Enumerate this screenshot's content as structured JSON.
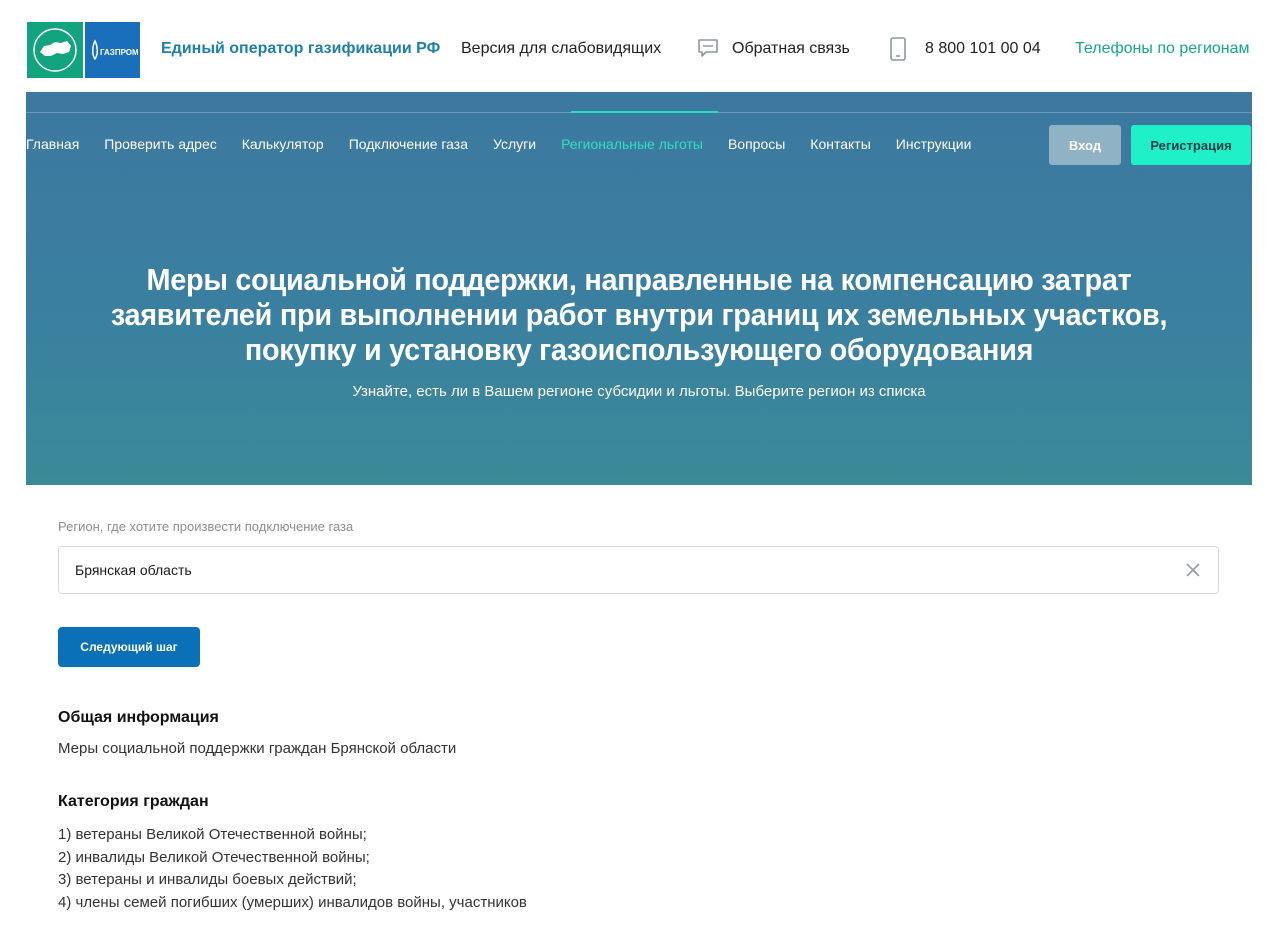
{
  "header": {
    "brand": "Единый оператор газификации РФ",
    "accessibility_link": "Версия для слабовидящих",
    "feedback_link": "Обратная связь",
    "phone": "8 800 101 00 04",
    "regions_link": "Телефоны по регионам",
    "logo_text_gazprom": "ГАЗПРОМ"
  },
  "nav": {
    "items": [
      {
        "label": "Главная"
      },
      {
        "label": "Проверить адрес"
      },
      {
        "label": "Калькулятор"
      },
      {
        "label": "Подключение газа"
      },
      {
        "label": "Услуги"
      },
      {
        "label": "Региональные льготы"
      },
      {
        "label": "Вопросы"
      },
      {
        "label": "Контакты"
      },
      {
        "label": "Инструкции"
      }
    ],
    "active_index": 5,
    "login_label": "Вход",
    "register_label": "Регистрация"
  },
  "hero": {
    "title": "Меры социальной поддержки, направленные на компенсацию затрат заявителей при выполнении работ внутри границ их земельных участков, покупку и установку газоиспользующего оборудования",
    "subtitle": "Узнайте, есть ли в Вашем регионе субсидии и льготы. Выберите регион из списка"
  },
  "form": {
    "region_label": "Регион, где хотите произвести подключение газа",
    "region_value": "Брянская область",
    "next_button": "Следующий шаг"
  },
  "info": {
    "general_title": "Общая информация",
    "general_text": "Меры социальной поддержки граждан Брянской области",
    "category_title": "Категория граждан",
    "categories": [
      "1) ветераны Великой Отечественной войны;",
      "2) инвалиды Великой Отечественной войны;",
      "3) ветераны и инвалиды боевых действий;",
      "4) члены семей погибших (умерших) инвалидов войны, участников"
    ]
  },
  "colors": {
    "brand_teal": "#13a886",
    "brand_blue": "#1f80a8",
    "hero_bg": "#3a7fa0",
    "nav_active": "#31e0bd",
    "register_bg": "#1ff0c8",
    "login_bg": "#8fb3c4",
    "primary_button": "#0a70b8"
  },
  "icons": {
    "feedback": "chat-bubble-icon",
    "phone": "mobile-phone-icon",
    "clear": "close-icon"
  }
}
